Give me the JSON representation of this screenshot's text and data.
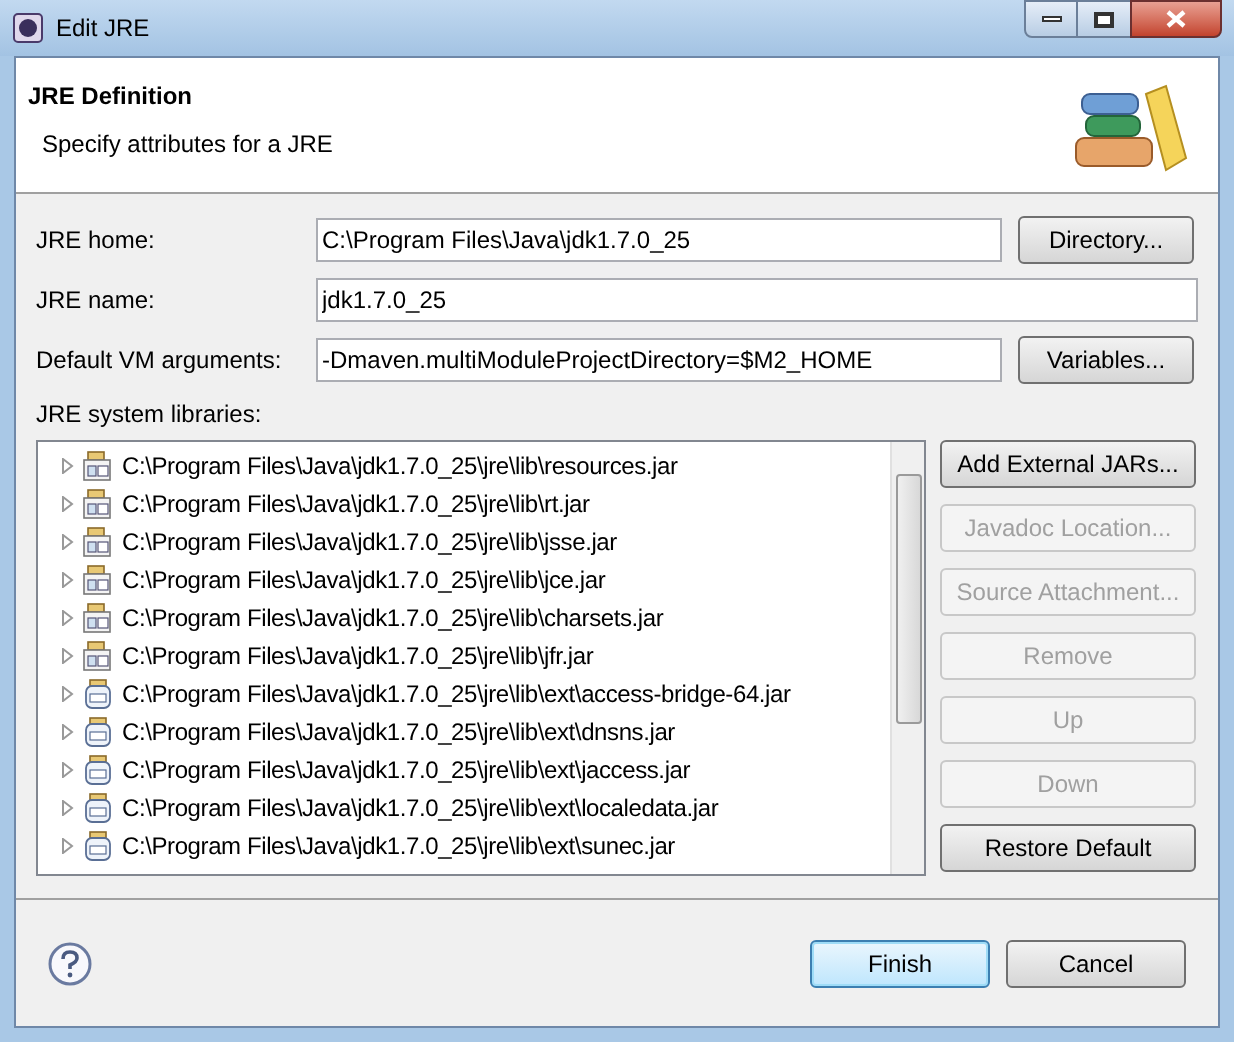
{
  "window": {
    "title": "Edit JRE"
  },
  "header": {
    "title": "JRE Definition",
    "subtitle": "Specify attributes for a JRE"
  },
  "fields": [
    {
      "label": "JRE home:",
      "value": "C:\\Program Files\\Java\\jdk1.7.0_25",
      "button": "Directory..."
    },
    {
      "label": "JRE name:",
      "value": "jdk1.7.0_25"
    },
    {
      "label": "Default VM arguments:",
      "value": "-Dmaven.multiModuleProjectDirectory=$M2_HOME",
      "button": "Variables..."
    }
  ],
  "libraries": {
    "label": "JRE system libraries:",
    "items": [
      {
        "kind": "lib",
        "path": "C:\\Program Files\\Java\\jdk1.7.0_25\\jre\\lib\\resources.jar"
      },
      {
        "kind": "lib",
        "path": "C:\\Program Files\\Java\\jdk1.7.0_25\\jre\\lib\\rt.jar"
      },
      {
        "kind": "lib",
        "path": "C:\\Program Files\\Java\\jdk1.7.0_25\\jre\\lib\\jsse.jar"
      },
      {
        "kind": "lib",
        "path": "C:\\Program Files\\Java\\jdk1.7.0_25\\jre\\lib\\jce.jar"
      },
      {
        "kind": "lib",
        "path": "C:\\Program Files\\Java\\jdk1.7.0_25\\jre\\lib\\charsets.jar"
      },
      {
        "kind": "lib",
        "path": "C:\\Program Files\\Java\\jdk1.7.0_25\\jre\\lib\\jfr.jar"
      },
      {
        "kind": "ext",
        "path": "C:\\Program Files\\Java\\jdk1.7.0_25\\jre\\lib\\ext\\access-bridge-64.jar"
      },
      {
        "kind": "ext",
        "path": "C:\\Program Files\\Java\\jdk1.7.0_25\\jre\\lib\\ext\\dnsns.jar"
      },
      {
        "kind": "ext",
        "path": "C:\\Program Files\\Java\\jdk1.7.0_25\\jre\\lib\\ext\\jaccess.jar"
      },
      {
        "kind": "ext",
        "path": "C:\\Program Files\\Java\\jdk1.7.0_25\\jre\\lib\\ext\\localedata.jar"
      },
      {
        "kind": "ext",
        "path": "C:\\Program Files\\Java\\jdk1.7.0_25\\jre\\lib\\ext\\sunec.jar"
      }
    ],
    "buttons": [
      {
        "label": "Add External JARs...",
        "disabled": false
      },
      {
        "label": "Javadoc Location...",
        "disabled": true
      },
      {
        "label": "Source Attachment...",
        "disabled": true
      },
      {
        "label": "Remove",
        "disabled": true
      },
      {
        "label": "Up",
        "disabled": true
      },
      {
        "label": "Down",
        "disabled": true
      },
      {
        "label": "Restore Default",
        "disabled": false
      }
    ]
  },
  "footer": {
    "buttons": [
      {
        "label": "Finish",
        "default": true
      },
      {
        "label": "Cancel",
        "default": false
      }
    ]
  }
}
